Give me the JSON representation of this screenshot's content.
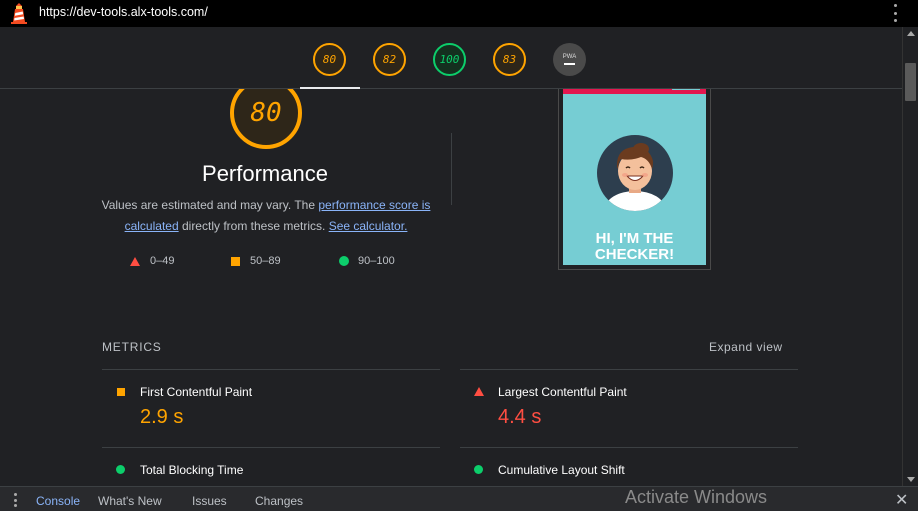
{
  "url_bar": {
    "url": "https://dev-tools.alx-tools.com/",
    "menu_icon": "kebab-vertical-icon",
    "logo_icon": "lighthouse-icon"
  },
  "score_tabs": [
    {
      "score": "80",
      "status": "orange",
      "active": true
    },
    {
      "score": "82",
      "status": "orange",
      "active": false
    },
    {
      "score": "100",
      "status": "green",
      "active": false
    },
    {
      "score": "83",
      "status": "orange",
      "active": false
    },
    {
      "score": "PWA",
      "status": "na",
      "active": false
    }
  ],
  "performance": {
    "score": "80",
    "title": "Performance",
    "desc_part1": "Values are estimated and may vary. The ",
    "desc_link1": "performance score is calculated",
    "desc_part2": " directly from these metrics. ",
    "desc_link2": "See calculator."
  },
  "legend": [
    {
      "range": "0–49",
      "shape": "triangle",
      "color": "#ff4e42"
    },
    {
      "range": "50–89",
      "shape": "square",
      "color": "#ffa400"
    },
    {
      "range": "90–100",
      "shape": "circle",
      "color": "#0cce6b"
    }
  ],
  "screenshot_thumb": {
    "text": "HI, I'M THE CHECKER!",
    "bg_color": "#76cdd3",
    "bar_color": "#e4174f"
  },
  "metrics": {
    "label": "METRICS",
    "expand": "Expand view",
    "items": [
      {
        "name": "First Contentful Paint",
        "value": "2.9 s",
        "status": "average",
        "color": "#ffa400"
      },
      {
        "name": "Largest Contentful Paint",
        "value": "4.4 s",
        "status": "fail",
        "color": "#ff4e42"
      },
      {
        "name": "Total Blocking Time",
        "value": "",
        "status": "pass",
        "color": "#0cce6b"
      },
      {
        "name": "Cumulative Layout Shift",
        "value": "",
        "status": "pass",
        "color": "#0cce6b"
      }
    ]
  },
  "drawer": {
    "tabs": [
      "Console",
      "What's New",
      "Issues",
      "Changes"
    ],
    "active_tab": "Console",
    "watermark": "Activate Windows",
    "close_icon": "close-icon"
  },
  "colors": {
    "orange": "#ffa400",
    "green": "#0cce6b",
    "red": "#ff4e42",
    "link": "#8ab4f8"
  }
}
